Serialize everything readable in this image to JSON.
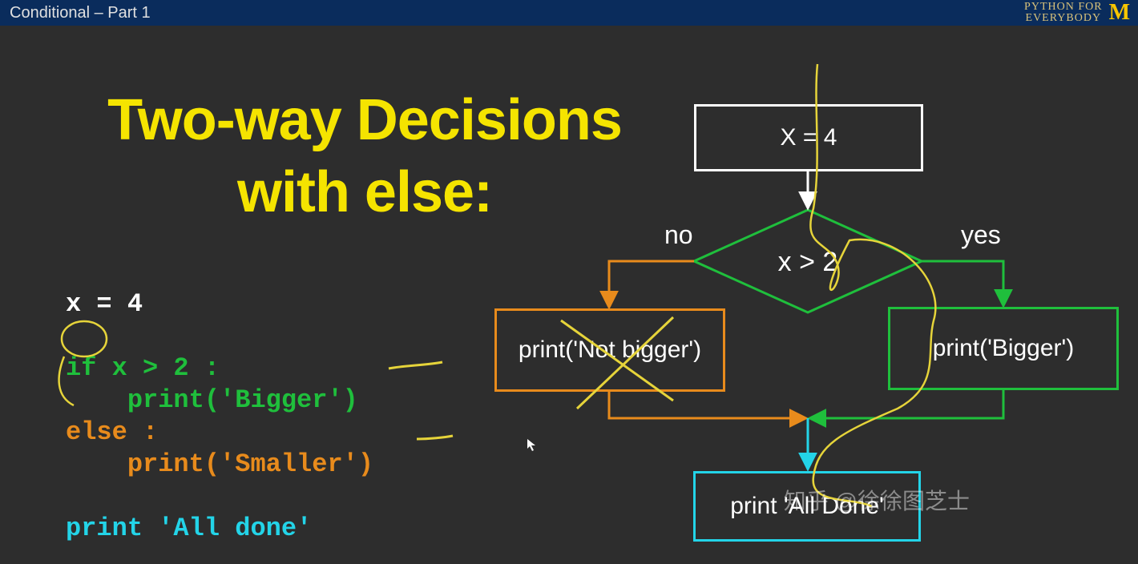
{
  "topbar": {
    "title": "Conditional – Part 1",
    "brand_line1": "PYTHON FOR",
    "brand_line2": "EVERYBODY",
    "logo_letter": "M"
  },
  "slide": {
    "title": "Two-way Decisions with else:"
  },
  "code": {
    "l1": "x = 4",
    "l2": "if x > 2 :",
    "l3": "    print('Bigger')",
    "l4": "else :",
    "l5": "    print('Smaller')",
    "l6": "print 'All done'"
  },
  "flow": {
    "start": "X = 4",
    "cond": "x > 2",
    "label_no": "no",
    "label_yes": "yes",
    "left_box": "print('Not bigger')",
    "right_box": "print('Bigger')",
    "end_box": "print 'All Done'"
  },
  "annotation": {
    "underline1": "—",
    "underline2": "—"
  },
  "watermark": "知乎 @徐徐图芝士"
}
